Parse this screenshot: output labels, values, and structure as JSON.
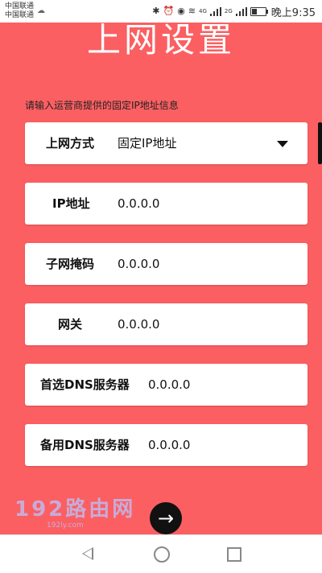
{
  "status": {
    "carrier1": "中国联通",
    "carrier2": "中国联通",
    "time": "晚上9:35",
    "net1": "4G",
    "net2": "2G"
  },
  "page": {
    "title": "上网设置",
    "hint": "请输入运营商提供的固定IP地址信息"
  },
  "form": {
    "rows": [
      {
        "label": "上网方式",
        "value": "固定IP地址"
      },
      {
        "label": "IP地址",
        "value": "0.0.0.0"
      },
      {
        "label": "子网掩码",
        "value": "0.0.0.0"
      },
      {
        "label": "网关",
        "value": "0.0.0.0"
      },
      {
        "label": "首选DNS服务器",
        "value": "0.0.0.0"
      },
      {
        "label": "备用DNS服务器",
        "value": "0.0.0.0"
      }
    ]
  },
  "footer": {
    "watermark": "192路由网",
    "watermark_sub": "192ly.com",
    "next_glyph": "→"
  },
  "colors": {
    "background": "#fb5f62",
    "card": "#ffffff",
    "button": "#111111"
  },
  "icons": {
    "bluetooth": "bluetooth-icon",
    "alarm": "alarm-icon",
    "eye": "eye-comfort-icon",
    "wifi": "wifi-icon",
    "battery": "battery-icon",
    "dropdown": "caret-down-icon",
    "next": "arrow-right-icon"
  }
}
